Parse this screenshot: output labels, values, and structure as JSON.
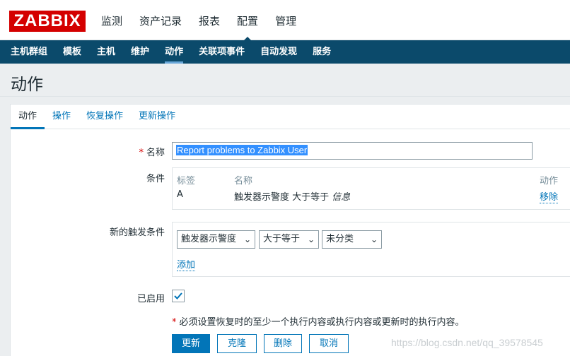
{
  "logo": "ZABBIX",
  "top_nav": [
    "监测",
    "资产记录",
    "报表",
    "配置",
    "管理"
  ],
  "top_nav_active": 3,
  "sub_nav": [
    "主机群组",
    "模板",
    "主机",
    "维护",
    "动作",
    "关联项事件",
    "自动发现",
    "服务"
  ],
  "sub_nav_active": 4,
  "page_title": "动作",
  "tabs": [
    "动作",
    "操作",
    "恢复操作",
    "更新操作"
  ],
  "form": {
    "name_label": "名称",
    "name_value": "Report problems to Zabbix User",
    "conditions_label": "条件",
    "conditions_headers": {
      "tag": "标签",
      "name": "名称",
      "action": "动作"
    },
    "condition_row": {
      "tag": "A",
      "name_prefix": "触发器示警度 大于等于",
      "name_value": "信息",
      "action": "移除"
    },
    "new_condition_label": "新的触发条件",
    "selects": [
      "触发器示警度",
      "大于等于",
      "未分类"
    ],
    "add_link": "添加",
    "enabled_label": "已启用",
    "enabled": true,
    "required_note": "必须设置恢复时的至少一个执行内容或执行内容或更新时的执行内容。"
  },
  "buttons": {
    "update": "更新",
    "clone": "克隆",
    "delete": "删除",
    "cancel": "取消"
  },
  "watermark": "https://blog.csdn.net/qq_39578545",
  "colors": {
    "brand": "#d40000",
    "nav": "#0b4a6b",
    "link": "#0275b8"
  }
}
